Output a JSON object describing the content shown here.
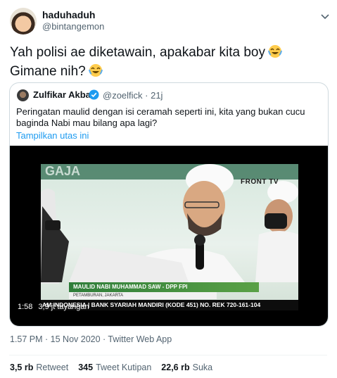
{
  "author": {
    "name": "haduhaduh",
    "handle": "@bintangemon"
  },
  "tweet": {
    "line1": "Yah polisi ae diketawain, apakabar kita boy",
    "line2": "Gimane nih?",
    "emoji": "face-with-tears-of-joy"
  },
  "quoted": {
    "name": "Zulfikar Akbar",
    "handle": "@zoelfick · 21j",
    "text": "Peringatan maulid dengan isi ceramah seperti ini, kita yang bukan cucu baginda Nabi mau bilang apa lagi?",
    "show_thread": "Tampilkan utas ini",
    "video": {
      "channel_logo": "FRONT TV",
      "lower_third_title": "MAULID NABI MUHAMMAD SAW - DPP FPI",
      "lower_third_sub": "PETAMBURAN, JAKARTA",
      "ticker": "AM INDONESIA | BANK SYARIAH MANDIRI (KODE 451) NO. REK 720-161-104",
      "duration": "1:58",
      "views": "3,9 jt tayangan"
    }
  },
  "meta": "1.57 PM · 15 Nov 2020 · Twitter Web App",
  "stats": {
    "retweets_count": "3,5 rb",
    "retweets_label": "Retweet",
    "quotes_count": "345",
    "quotes_label": "Tweet Kutipan",
    "likes_count": "22,6 rb",
    "likes_label": "Suka"
  },
  "colors": {
    "link": "#1d9bf0",
    "secondary": "#536471",
    "border": "#cfd9de"
  }
}
